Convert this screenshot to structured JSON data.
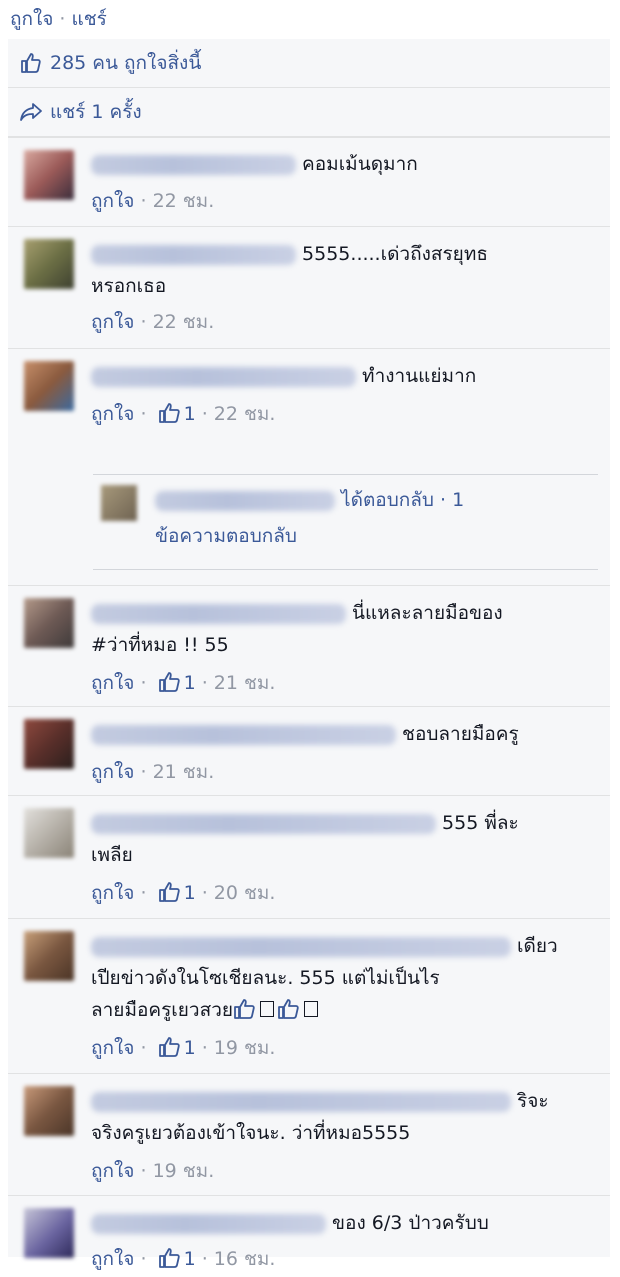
{
  "topbar": {
    "like": "ถูกใจ",
    "sep": "·",
    "share": "แชร์"
  },
  "summary": {
    "likes": "285 คน ถูกใจสิ่งนี้",
    "shares": "แชร์ 1 ครั้ง"
  },
  "labels": {
    "like": "ถูกใจ",
    "sep": "·"
  },
  "comments": [
    {
      "text1": "คอมเม้นดุมาก",
      "text2": "",
      "likes": "",
      "time": "22 ชม."
    },
    {
      "text1": "5555.....เด่วถึงสรยุทธ",
      "text2": "หรอกเธอ",
      "likes": "",
      "time": "22 ชม."
    },
    {
      "text1": "ทำงานแย่มาก",
      "text2": "",
      "likes": "1",
      "time": "22 ชม."
    },
    {
      "text1": "นี่แหละลายมือของ",
      "text2": "#ว่าที่หมอ !! 55",
      "likes": "1",
      "time": "21 ชม."
    },
    {
      "text1": "ชอบลายมือครู",
      "text2": "",
      "likes": "",
      "time": "21 ชม."
    },
    {
      "text1": "555 พี่ละ",
      "text2": "เพลีย",
      "likes": "1",
      "time": "20 ชม."
    },
    {
      "text1": "เดียว",
      "text2": "เปียข่าวดังในโซเชียลนะ. 555 แต่ไม่เป็นไร",
      "text3": "ลายมือครูเยวสวย",
      "likes": "1",
      "time": "19 ชม."
    },
    {
      "text1": "ริจะ",
      "text2": "จริงครูเยวต้องเข้าใจนะ. ว่าที่หมอ5555",
      "likes": "",
      "time": "19 ชม."
    },
    {
      "text1": "ของ 6/3 ป่าวครับบ",
      "text2": "",
      "likes": "1",
      "time": "16 ชม."
    }
  ],
  "reply": {
    "replied": "ได้ตอบกลับ",
    "sep": "·",
    "count": "1",
    "label": "ข้อความตอบกลับ"
  },
  "colors": {
    "link": "#3b5998",
    "meta": "#9197a3",
    "panel": "#f6f7f9",
    "divider": "#e1e2e3"
  }
}
